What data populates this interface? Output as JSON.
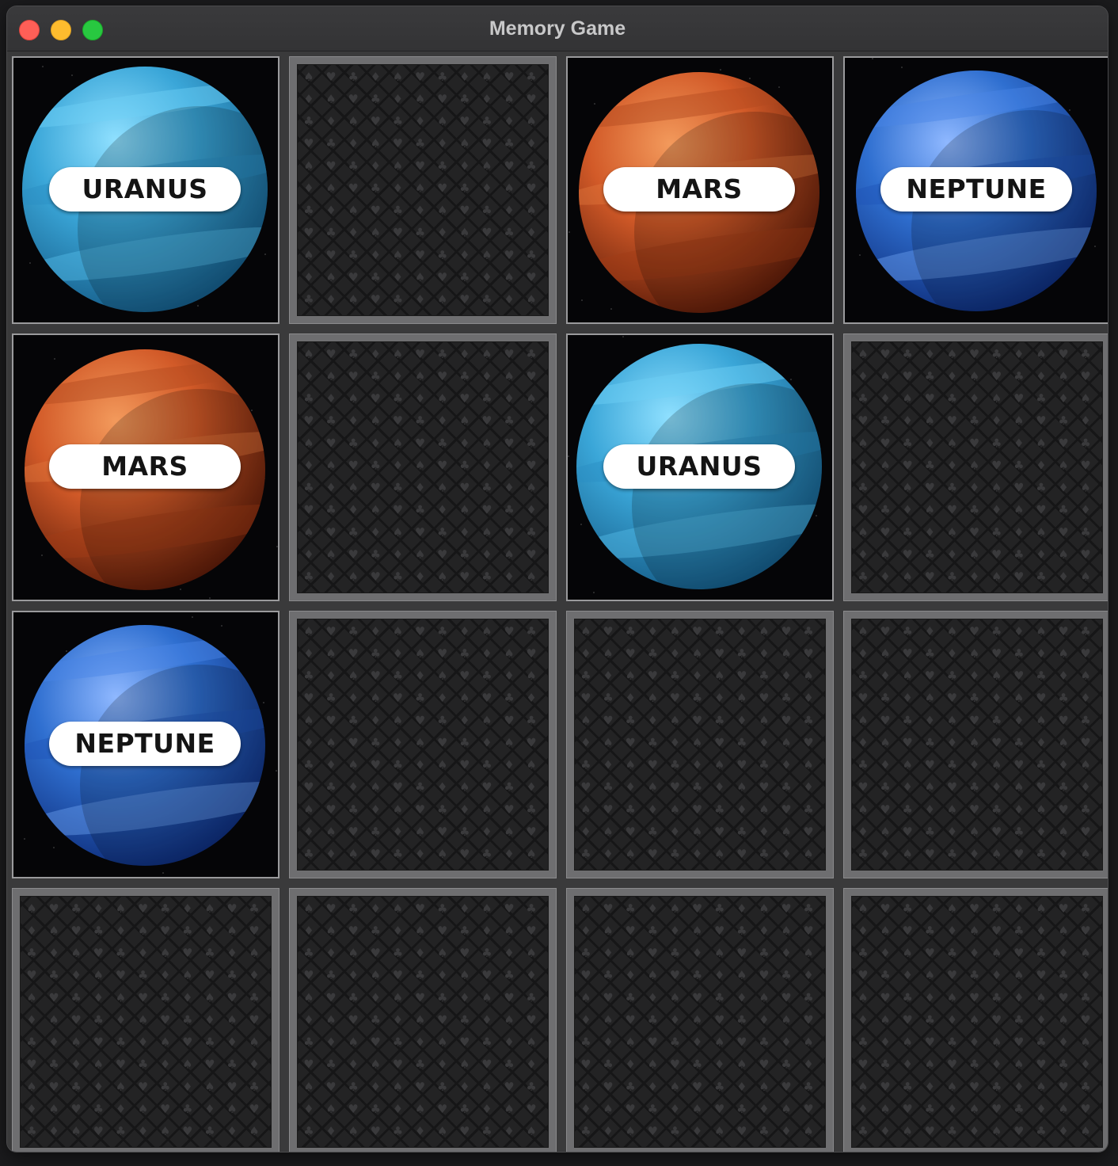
{
  "window": {
    "title": "Memory Game"
  },
  "board": {
    "rows": 4,
    "columns": 4,
    "cards": [
      {
        "state": "face-up",
        "label": "URANUS",
        "planet": "uranus"
      },
      {
        "state": "face-down",
        "label": "",
        "planet": ""
      },
      {
        "state": "face-up",
        "label": "MARS",
        "planet": "mars"
      },
      {
        "state": "face-up",
        "label": "NEPTUNE",
        "planet": "neptune"
      },
      {
        "state": "face-up",
        "label": "MARS",
        "planet": "mars"
      },
      {
        "state": "face-down",
        "label": "",
        "planet": ""
      },
      {
        "state": "face-up",
        "label": "URANUS",
        "planet": "uranus"
      },
      {
        "state": "face-down",
        "label": "",
        "planet": ""
      },
      {
        "state": "face-up",
        "label": "NEPTUNE",
        "planet": "neptune"
      },
      {
        "state": "face-down",
        "label": "",
        "planet": ""
      },
      {
        "state": "face-down",
        "label": "",
        "planet": ""
      },
      {
        "state": "face-down",
        "label": "",
        "planet": ""
      },
      {
        "state": "face-down",
        "label": "",
        "planet": ""
      },
      {
        "state": "face-down",
        "label": "",
        "planet": ""
      },
      {
        "state": "face-down",
        "label": "",
        "planet": ""
      },
      {
        "state": "face-down",
        "label": "",
        "planet": ""
      }
    ]
  },
  "colors": {
    "window_bg": "#353536",
    "card_back": "#232324",
    "card_back_frame": "#6e6e70",
    "uranus": "#3aa6d8",
    "mars": "#d25a28",
    "neptune": "#2f6fd0"
  }
}
